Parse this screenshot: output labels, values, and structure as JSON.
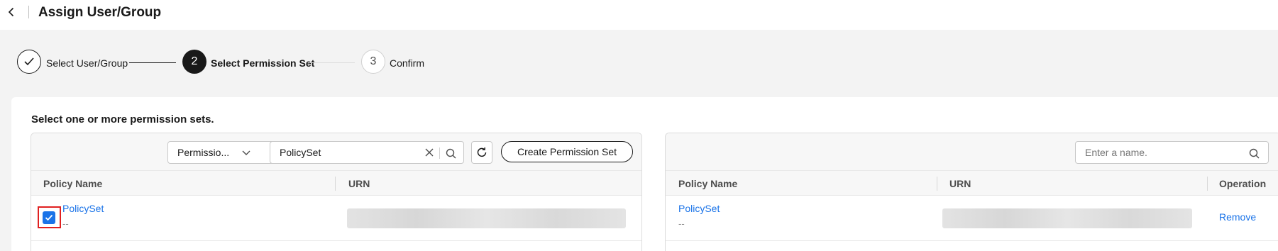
{
  "header": {
    "title": "Assign User/Group"
  },
  "steps": [
    {
      "number": "",
      "label": "Select User/Group",
      "state": "done"
    },
    {
      "number": "2",
      "label": "Select Permission Set",
      "state": "active"
    },
    {
      "number": "3",
      "label": "Confirm",
      "state": "pending"
    }
  ],
  "instruction": "Select one or more permission sets.",
  "left_panel": {
    "filter_select": "Permissio...",
    "search_value": "PolicySet",
    "create_button": "Create Permission Set",
    "columns": {
      "name": "Policy Name",
      "urn": "URN"
    },
    "rows": [
      {
        "name": "PolicySet",
        "description": "--",
        "checked": true
      }
    ]
  },
  "right_panel": {
    "search_placeholder": "Enter a name.",
    "columns": {
      "name": "Policy Name",
      "urn": "URN",
      "operation": "Operation"
    },
    "rows": [
      {
        "name": "PolicySet",
        "description": "--",
        "action": "Remove"
      }
    ]
  },
  "colors": {
    "accent": "#1a73e8",
    "step_active": "#191919",
    "highlight_frame": "#e02020"
  },
  "icons": [
    "chevron-left-icon",
    "check-icon",
    "chevron-down-icon",
    "clear-icon",
    "search-icon",
    "refresh-icon"
  ]
}
